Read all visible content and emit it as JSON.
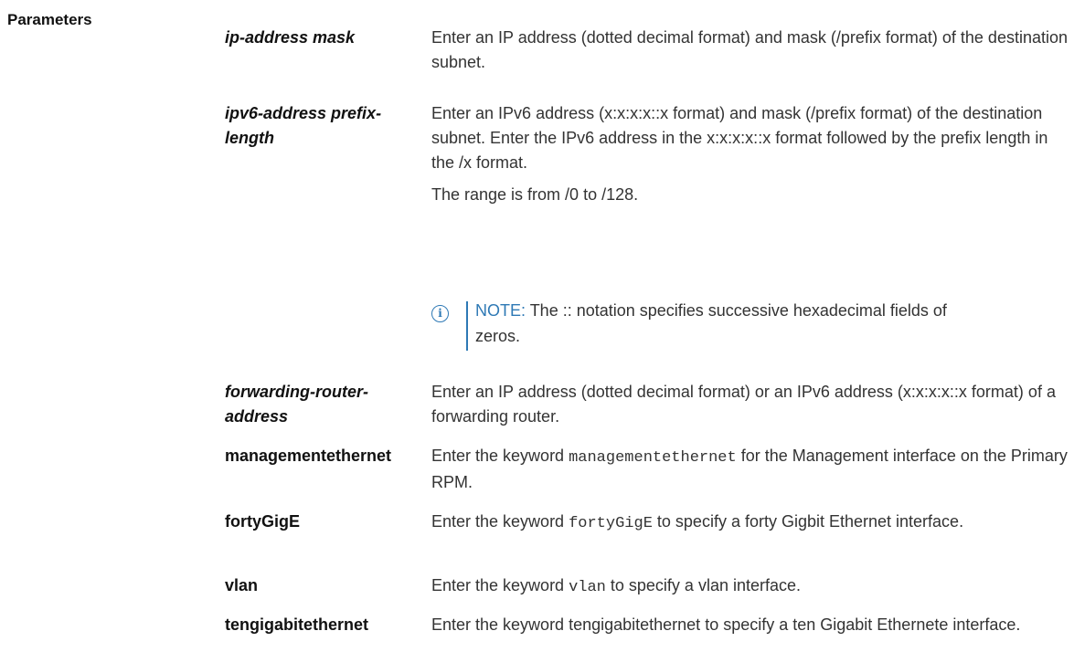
{
  "section": {
    "label": "Parameters"
  },
  "rows": [
    {
      "param": "ip-address mask",
      "desc": "Enter an IP address (dotted decimal format) and mask (/prefix format) of the destination subnet."
    },
    {
      "param": "ipv6-address prefix-length",
      "desc": "Enter an IPv6 address (x:x:x:x::x format) and mask (/prefix format) of the destination subnet. Enter the IPv6 address in the x:x:x:x::x format followed by the prefix length in the /x format.",
      "desc2": "The range is from /0 to /128."
    },
    {
      "param": "forwarding-router-address",
      "desc": "Enter an IP address (dotted decimal format) or an IPv6 address (x:x:x:x::x format) of a forwarding router."
    },
    {
      "param": "managementethernet",
      "desc_pre": "Enter the keyword ",
      "desc_code": "managementethernet",
      "desc_post": " for the Management interface on the Primary RPM."
    },
    {
      "param": "fortyGigE",
      "desc_pre": "Enter the keyword ",
      "desc_code": "fortyGigE",
      "desc_post": " to specify a forty Gigbit Ethernet interface."
    },
    {
      "param": "vlan",
      "desc_pre": "Enter the keyword ",
      "desc_code": "vlan",
      "desc_post": " to specify a vlan interface."
    },
    {
      "param": "tengigabitethernet",
      "desc": "Enter the keyword tengigabitethernet to specify a ten Gigabit Ethernete interface."
    }
  ],
  "note": {
    "label": "NOTE:",
    "text": " The :: notation specifies successive hexadecimal fields of zeros.",
    "icon": "info-icon"
  }
}
